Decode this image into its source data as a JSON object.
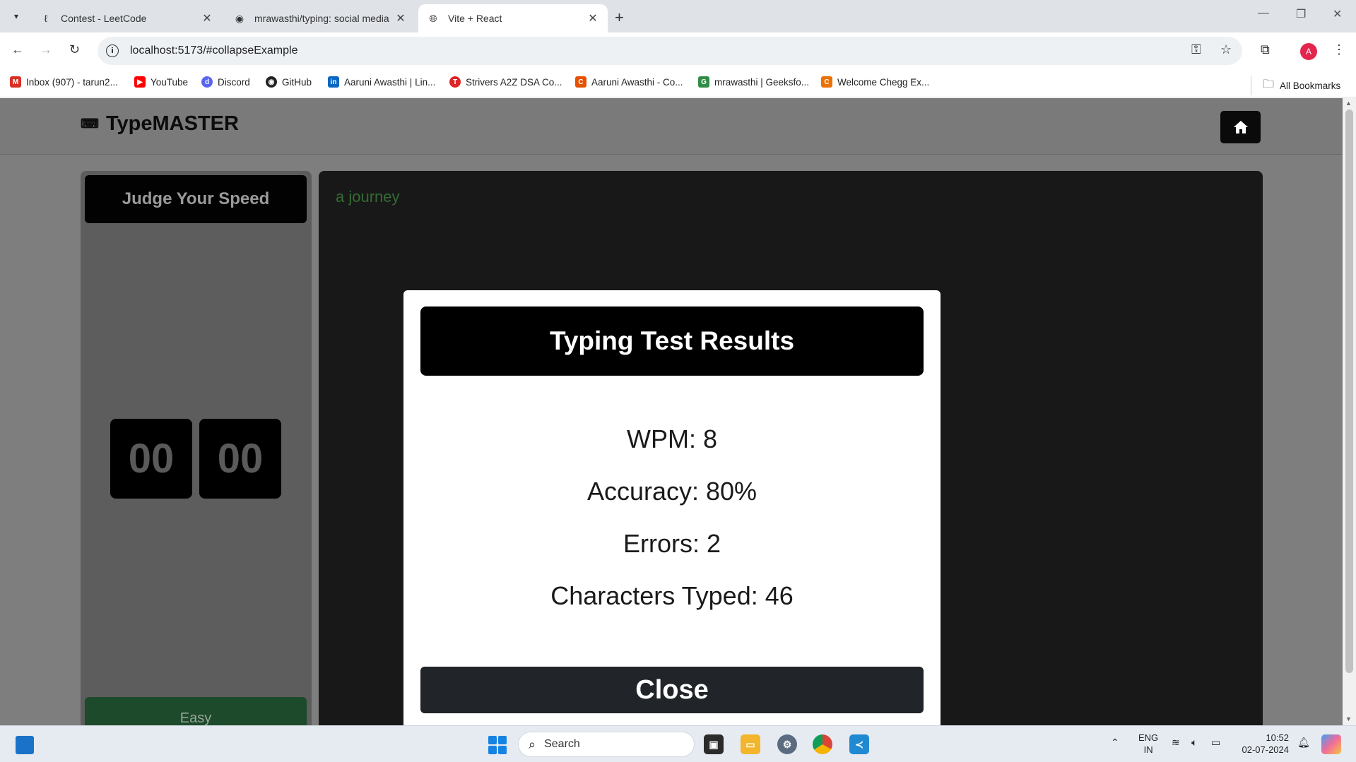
{
  "browser": {
    "tabs": [
      {
        "title": "Contest - LeetCode",
        "favicon": "leetcode-icon",
        "active": false
      },
      {
        "title": "mrawasthi/typing: social media",
        "favicon": "github-icon",
        "active": false
      },
      {
        "title": "Vite + React",
        "favicon": "globe-icon",
        "active": true
      }
    ],
    "url": "localhost:5173/#collapseExample",
    "profile_initial": "A",
    "bookmarks": [
      {
        "label": "Inbox (907) - tarun2...",
        "icon": "gmail-icon",
        "icon_text": "M",
        "color": "#d93025"
      },
      {
        "label": "YouTube",
        "icon": "youtube-icon",
        "icon_text": "▶",
        "color": "#ff0000"
      },
      {
        "label": "Discord",
        "icon": "discord-icon",
        "icon_text": "d",
        "color": "#5865f2"
      },
      {
        "label": "GitHub",
        "icon": "github-icon",
        "icon_text": "◉",
        "color": "#222222"
      },
      {
        "label": "Aaruni Awasthi | Lin...",
        "icon": "linkedin-icon",
        "icon_text": "in",
        "color": "#0a66c2"
      },
      {
        "label": "Strivers A2Z DSA Co...",
        "icon": "tuf-icon",
        "icon_text": "T",
        "color": "#e02424"
      },
      {
        "label": "Aaruni Awasthi - Co...",
        "icon": "codechef-icon",
        "icon_text": "C",
        "color": "#e65100"
      },
      {
        "label": "mrawasthi | Geeksfo...",
        "icon": "gfg-icon",
        "icon_text": "G",
        "color": "#2f8d46"
      },
      {
        "label": "Welcome Chegg Ex...",
        "icon": "chegg-icon",
        "icon_text": "C",
        "color": "#eb7100"
      }
    ],
    "all_bookmarks_label": "All Bookmarks"
  },
  "app": {
    "brand": "TypeMASTER",
    "left_panel": {
      "title": "Judge Your Speed",
      "timer_minutes": "00",
      "timer_seconds": "00",
      "difficulty": "Easy"
    },
    "typed_text_preview": "a journey"
  },
  "modal": {
    "title": "Typing Test Results",
    "wpm_text": "WPM: 8",
    "accuracy_text": "Accuracy: 80%",
    "errors_text": "Errors: 2",
    "chars_text": "Characters Typed: 46",
    "close_label": "Close"
  },
  "taskbar": {
    "search_label": "Search",
    "lang_line1": "ENG",
    "lang_line2": "IN",
    "time": "10:52",
    "date": "02-07-2024"
  }
}
